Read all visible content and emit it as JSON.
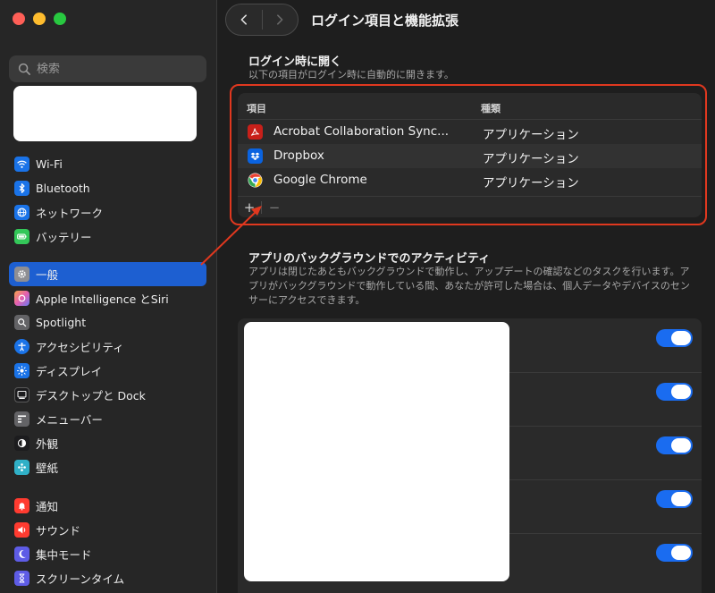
{
  "sidebar": {
    "search_placeholder": "検索",
    "group1": [
      {
        "label": "Wi-Fi",
        "icon": "wifi-icon",
        "color": "#1a73e8"
      },
      {
        "label": "Bluetooth",
        "icon": "bluetooth-icon",
        "color": "#1a73e8"
      },
      {
        "label": "ネットワーク",
        "icon": "globe-icon",
        "color": "#1a73e8"
      },
      {
        "label": "バッテリー",
        "icon": "battery-icon",
        "color": "#34c759"
      }
    ],
    "group2": [
      {
        "label": "一般",
        "icon": "gear-icon",
        "color": "#8e8e93",
        "active": true
      },
      {
        "label": "Apple Intelligence とSiri",
        "icon": "siri-icon",
        "color": "#c86dd7"
      },
      {
        "label": "Spotlight",
        "icon": "magnifier-icon",
        "color": "#636366"
      },
      {
        "label": "アクセシビリティ",
        "icon": "accessibility-icon",
        "color": "#1a73e8"
      },
      {
        "label": "ディスプレイ",
        "icon": "sun-icon",
        "color": "#1a73e8"
      },
      {
        "label": "デスクトップと Dock",
        "icon": "dock-icon",
        "color": "#1c1c1e"
      },
      {
        "label": "メニューバー",
        "icon": "menubar-icon",
        "color": "#636366"
      },
      {
        "label": "外観",
        "icon": "appearance-icon",
        "color": "#1c1c1e"
      },
      {
        "label": "壁紙",
        "icon": "wallpaper-icon",
        "color": "#30b0c7"
      }
    ],
    "group3": [
      {
        "label": "通知",
        "icon": "bell-icon",
        "color": "#ff3b30"
      },
      {
        "label": "サウンド",
        "icon": "speaker-icon",
        "color": "#ff3b30"
      },
      {
        "label": "集中モード",
        "icon": "moon-icon",
        "color": "#5e5ce6"
      },
      {
        "label": "スクリーンタイム",
        "icon": "hourglass-icon",
        "color": "#5e5ce6"
      }
    ]
  },
  "header": {
    "title": "ログイン項目と機能拡張"
  },
  "login_section": {
    "title": "ログイン時に開く",
    "description": "以下の項目がログイン時に自動的に開きます。",
    "columns": {
      "item": "項目",
      "kind": "種類"
    },
    "rows": [
      {
        "name": "Acrobat Collaboration Sync...",
        "kind": "アプリケーション",
        "icon": "acrobat-icon"
      },
      {
        "name": "Dropbox",
        "kind": "アプリケーション",
        "icon": "dropbox-icon"
      },
      {
        "name": "Google Chrome",
        "kind": "アプリケーション",
        "icon": "chrome-icon"
      }
    ],
    "add_label": "+",
    "remove_label": "−"
  },
  "background_section": {
    "title": "アプリのバックグラウンドでのアクティビティ",
    "description": "アプリは閉じたあともバックグラウンドで動作し、アップデートの確認などのタスクを行います。アプリがバックグラウンドで動作している間、あなたが許可した場合は、個人データやデバイスのセンサーにアクセスできます。",
    "toggles": [
      true,
      true,
      true,
      true,
      true
    ]
  },
  "colors": {
    "accent": "#1a6cf0",
    "highlight": "#e0381f",
    "active_sidebar": "#1d5fd1"
  }
}
